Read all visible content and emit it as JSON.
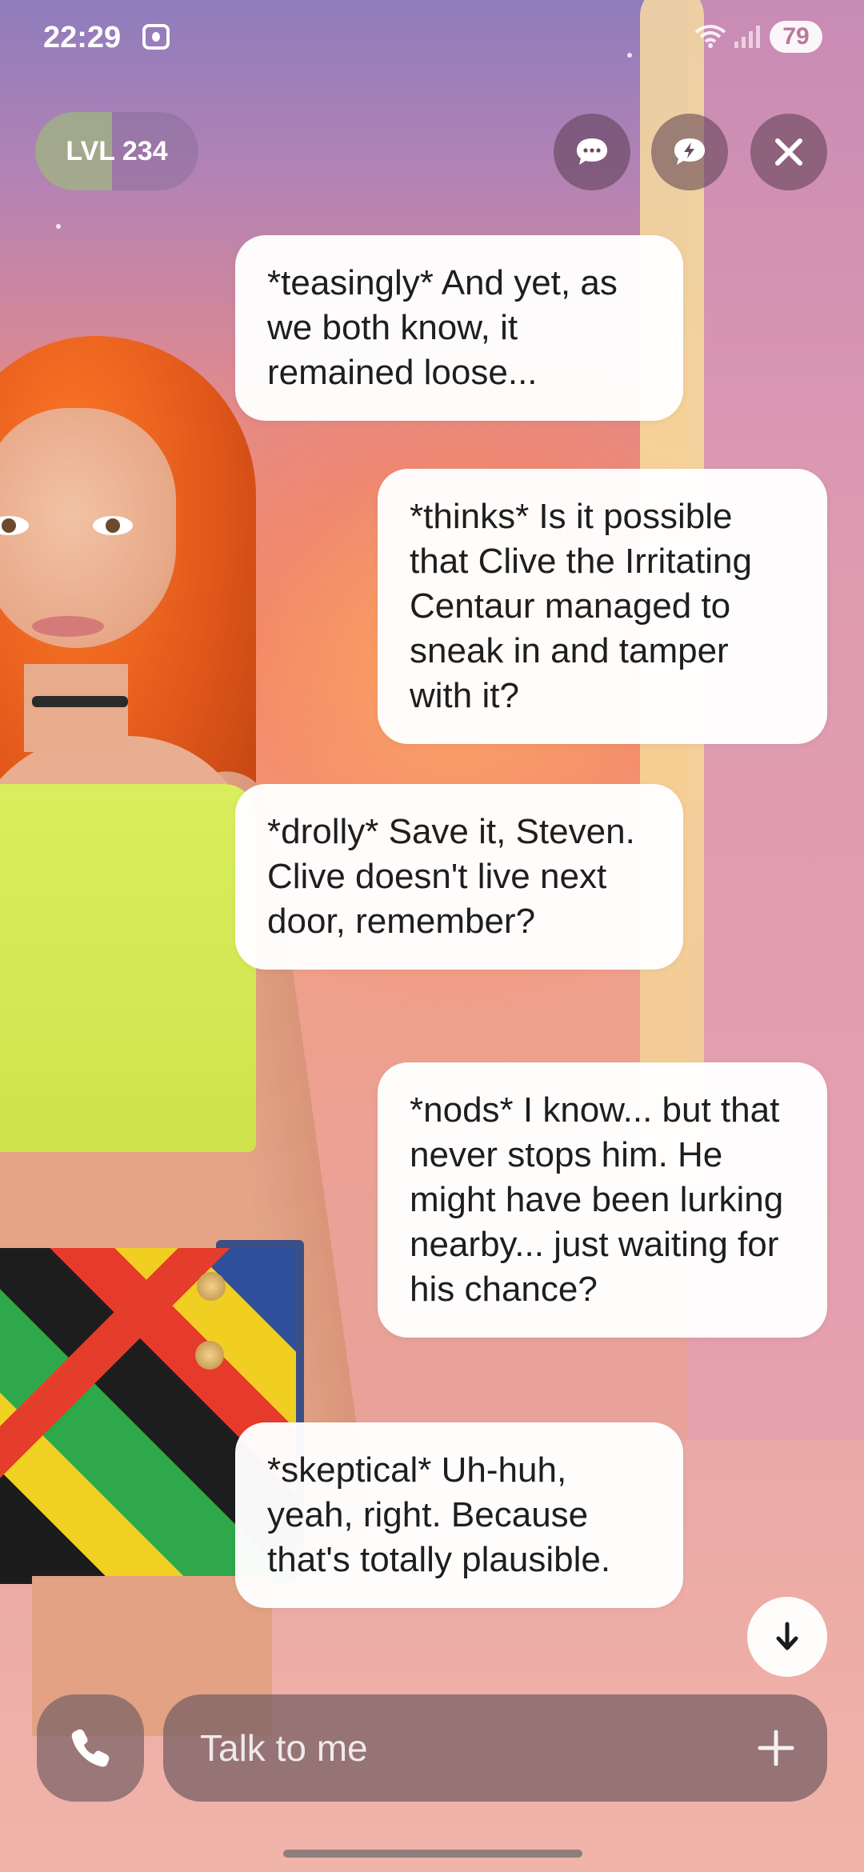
{
  "status_bar": {
    "time": "22:29",
    "battery": "79",
    "icons": [
      "screen-record-icon",
      "wifi-icon",
      "signal-icon",
      "battery-icon"
    ]
  },
  "header": {
    "level_label": "LVL 234",
    "level_progress": 0.47,
    "buttons": [
      "chat-bubble-icon",
      "lightning-chat-icon",
      "close-icon"
    ]
  },
  "messages": [
    {
      "role": "ai",
      "text": "*teasingly* And yet, as we both know, it remained loose..."
    },
    {
      "role": "user",
      "text": "*thinks* Is it possible that Clive the Irritating Centaur managed to sneak in and tamper with it?"
    },
    {
      "role": "ai",
      "text": "*drolly* Save it, Steven. Clive doesn't live next door, remember?"
    },
    {
      "role": "user",
      "text": "*nods* I know... but that never stops him. He might have been lurking nearby... just waiting for his chance?"
    },
    {
      "role": "ai",
      "text": "*skeptical* Uh-huh, yeah, right. Because that's totally plausible."
    }
  ],
  "composer": {
    "placeholder": "Talk to me"
  },
  "colors": {
    "bubble": "#ffffff",
    "controls": "#5a3c50",
    "level_fill": "#aad278"
  }
}
